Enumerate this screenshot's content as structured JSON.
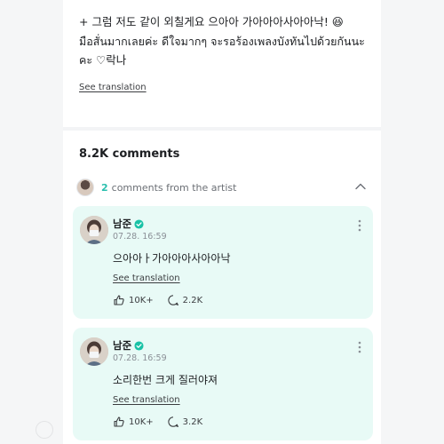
{
  "post": {
    "text_line1": "+ 그럼 저도 같이 외칠게요 으아아 가아아아사아아낙! 😆",
    "text_line2": "มือสั่นมากเลยค่ะ ดีใจมากๆ จะรอร้องเพลงบังทันไปด้วยกันนะ",
    "text_line3": "คะ ♡락나",
    "see_translation": "See translation"
  },
  "comments": {
    "count_label": "8.2K comments",
    "artist_count": "2",
    "artist_label": "comments from the artist"
  },
  "artist_comments": [
    {
      "author": "남준",
      "date": "07.28. 16:59",
      "text": "으아아ㅏ가아아아사아아낙",
      "see_translation": "See translation",
      "likes": "10K+",
      "replies": "2.2K"
    },
    {
      "author": "남준",
      "date": "07.28. 16:59",
      "text": "소리한번 크게 질러야져",
      "see_translation": "See translation",
      "likes": "10K+",
      "replies": "3.2K"
    }
  ],
  "colors": {
    "accent": "#2bbfae",
    "card_bg": "#e8faf6",
    "verified": "#19c2a6"
  },
  "icons": [
    "mini-avatar",
    "chevron-up-icon",
    "verified-icon",
    "more-vertical-icon",
    "like-icon",
    "reply-icon"
  ]
}
